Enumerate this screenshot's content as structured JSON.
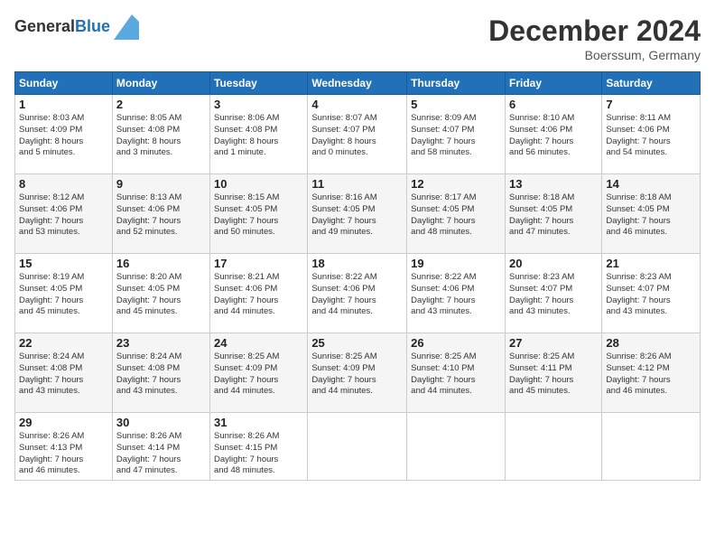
{
  "header": {
    "logo_line1": "General",
    "logo_line2": "Blue",
    "month": "December 2024",
    "location": "Boerssum, Germany"
  },
  "days_of_week": [
    "Sunday",
    "Monday",
    "Tuesday",
    "Wednesday",
    "Thursday",
    "Friday",
    "Saturday"
  ],
  "weeks": [
    [
      {
        "day": "1",
        "info": "Sunrise: 8:03 AM\nSunset: 4:09 PM\nDaylight: 8 hours\nand 5 minutes."
      },
      {
        "day": "2",
        "info": "Sunrise: 8:05 AM\nSunset: 4:08 PM\nDaylight: 8 hours\nand 3 minutes."
      },
      {
        "day": "3",
        "info": "Sunrise: 8:06 AM\nSunset: 4:08 PM\nDaylight: 8 hours\nand 1 minute."
      },
      {
        "day": "4",
        "info": "Sunrise: 8:07 AM\nSunset: 4:07 PM\nDaylight: 8 hours\nand 0 minutes."
      },
      {
        "day": "5",
        "info": "Sunrise: 8:09 AM\nSunset: 4:07 PM\nDaylight: 7 hours\nand 58 minutes."
      },
      {
        "day": "6",
        "info": "Sunrise: 8:10 AM\nSunset: 4:06 PM\nDaylight: 7 hours\nand 56 minutes."
      },
      {
        "day": "7",
        "info": "Sunrise: 8:11 AM\nSunset: 4:06 PM\nDaylight: 7 hours\nand 54 minutes."
      }
    ],
    [
      {
        "day": "8",
        "info": "Sunrise: 8:12 AM\nSunset: 4:06 PM\nDaylight: 7 hours\nand 53 minutes."
      },
      {
        "day": "9",
        "info": "Sunrise: 8:13 AM\nSunset: 4:06 PM\nDaylight: 7 hours\nand 52 minutes."
      },
      {
        "day": "10",
        "info": "Sunrise: 8:15 AM\nSunset: 4:05 PM\nDaylight: 7 hours\nand 50 minutes."
      },
      {
        "day": "11",
        "info": "Sunrise: 8:16 AM\nSunset: 4:05 PM\nDaylight: 7 hours\nand 49 minutes."
      },
      {
        "day": "12",
        "info": "Sunrise: 8:17 AM\nSunset: 4:05 PM\nDaylight: 7 hours\nand 48 minutes."
      },
      {
        "day": "13",
        "info": "Sunrise: 8:18 AM\nSunset: 4:05 PM\nDaylight: 7 hours\nand 47 minutes."
      },
      {
        "day": "14",
        "info": "Sunrise: 8:18 AM\nSunset: 4:05 PM\nDaylight: 7 hours\nand 46 minutes."
      }
    ],
    [
      {
        "day": "15",
        "info": "Sunrise: 8:19 AM\nSunset: 4:05 PM\nDaylight: 7 hours\nand 45 minutes."
      },
      {
        "day": "16",
        "info": "Sunrise: 8:20 AM\nSunset: 4:05 PM\nDaylight: 7 hours\nand 45 minutes."
      },
      {
        "day": "17",
        "info": "Sunrise: 8:21 AM\nSunset: 4:06 PM\nDaylight: 7 hours\nand 44 minutes."
      },
      {
        "day": "18",
        "info": "Sunrise: 8:22 AM\nSunset: 4:06 PM\nDaylight: 7 hours\nand 44 minutes."
      },
      {
        "day": "19",
        "info": "Sunrise: 8:22 AM\nSunset: 4:06 PM\nDaylight: 7 hours\nand 43 minutes."
      },
      {
        "day": "20",
        "info": "Sunrise: 8:23 AM\nSunset: 4:07 PM\nDaylight: 7 hours\nand 43 minutes."
      },
      {
        "day": "21",
        "info": "Sunrise: 8:23 AM\nSunset: 4:07 PM\nDaylight: 7 hours\nand 43 minutes."
      }
    ],
    [
      {
        "day": "22",
        "info": "Sunrise: 8:24 AM\nSunset: 4:08 PM\nDaylight: 7 hours\nand 43 minutes."
      },
      {
        "day": "23",
        "info": "Sunrise: 8:24 AM\nSunset: 4:08 PM\nDaylight: 7 hours\nand 43 minutes."
      },
      {
        "day": "24",
        "info": "Sunrise: 8:25 AM\nSunset: 4:09 PM\nDaylight: 7 hours\nand 44 minutes."
      },
      {
        "day": "25",
        "info": "Sunrise: 8:25 AM\nSunset: 4:09 PM\nDaylight: 7 hours\nand 44 minutes."
      },
      {
        "day": "26",
        "info": "Sunrise: 8:25 AM\nSunset: 4:10 PM\nDaylight: 7 hours\nand 44 minutes."
      },
      {
        "day": "27",
        "info": "Sunrise: 8:25 AM\nSunset: 4:11 PM\nDaylight: 7 hours\nand 45 minutes."
      },
      {
        "day": "28",
        "info": "Sunrise: 8:26 AM\nSunset: 4:12 PM\nDaylight: 7 hours\nand 46 minutes."
      }
    ],
    [
      {
        "day": "29",
        "info": "Sunrise: 8:26 AM\nSunset: 4:13 PM\nDaylight: 7 hours\nand 46 minutes."
      },
      {
        "day": "30",
        "info": "Sunrise: 8:26 AM\nSunset: 4:14 PM\nDaylight: 7 hours\nand 47 minutes."
      },
      {
        "day": "31",
        "info": "Sunrise: 8:26 AM\nSunset: 4:15 PM\nDaylight: 7 hours\nand 48 minutes."
      },
      null,
      null,
      null,
      null
    ]
  ]
}
